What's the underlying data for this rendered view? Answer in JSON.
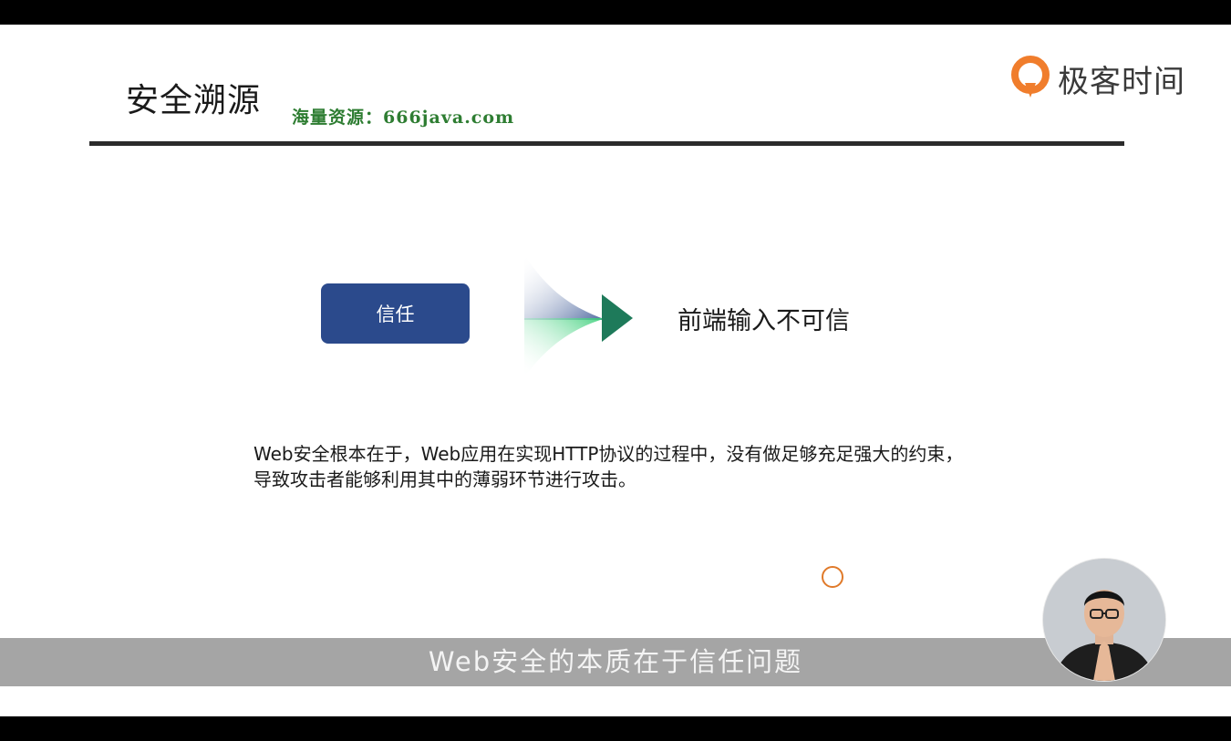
{
  "slide": {
    "title": "安全溯源",
    "watermark": "海量资源：666java.com",
    "logo": {
      "icon": "geek-time-logo-icon",
      "text": "极客时间",
      "brand_color": "#f07d2c"
    },
    "trust_label": "信任",
    "arrow": {
      "icon": "arrow-right-icon",
      "colors": [
        "#2b4a8c",
        "#2ecc71",
        "#1e7a5a"
      ]
    },
    "result": "前端输入不可信",
    "paragraph_line1": "Web安全根本在于，Web应用在实现HTTP协议的过程中，没有做足够充足强大的约束，",
    "paragraph_line2": "导致攻击者能够利用其中的薄弱环节进行攻击。"
  },
  "subtitle": "Web安全的本质在于信任问题",
  "presenter": {
    "icon": "presenter-avatar"
  }
}
